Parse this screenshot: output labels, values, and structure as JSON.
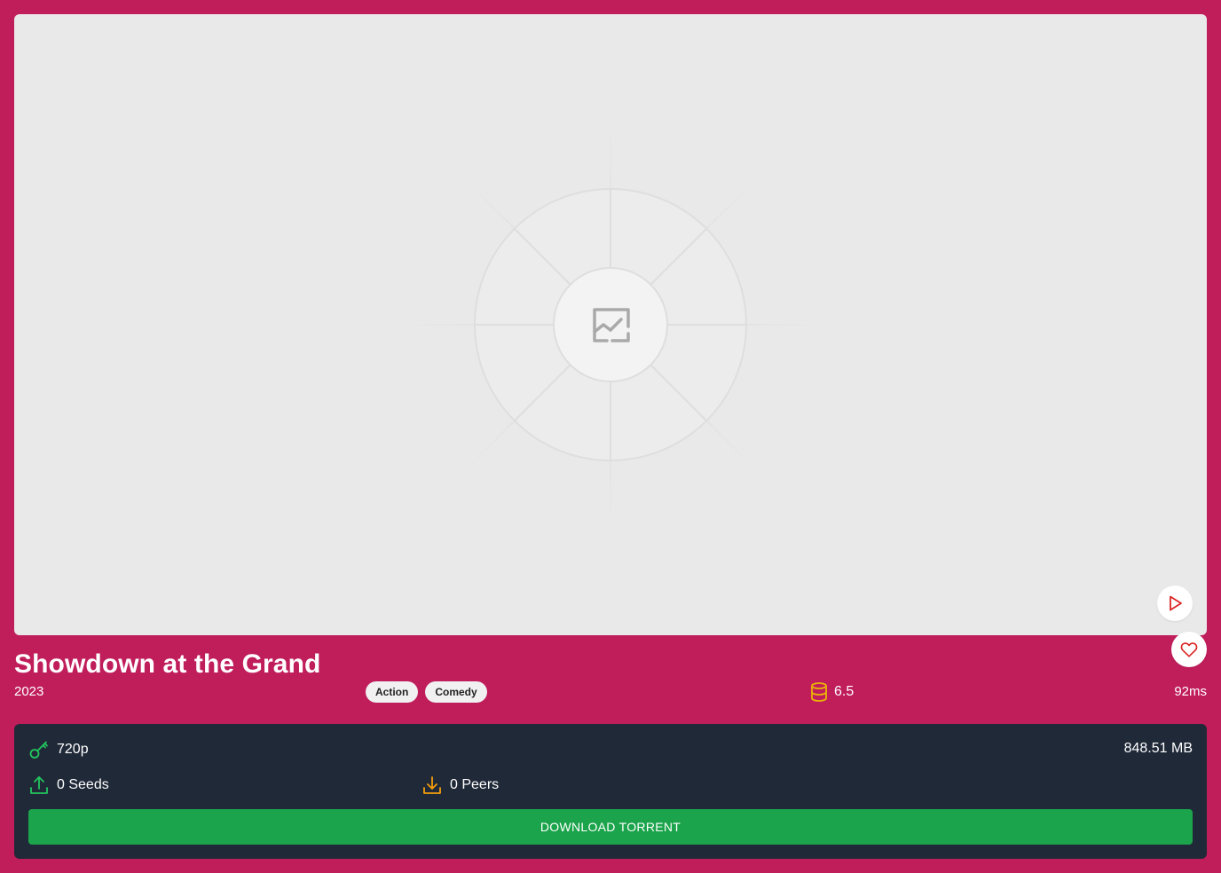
{
  "movie": {
    "title": "Showdown at the Grand",
    "year": "2023",
    "genres": [
      "Action",
      "Comedy"
    ],
    "rating": "6.5",
    "runtime": "92ms"
  },
  "poster": {
    "icon": "image-placeholder-icon"
  },
  "actions": {
    "play_icon": "play-icon",
    "favorite_icon": "heart-icon"
  },
  "torrent": {
    "quality": "720p",
    "size": "848.51 MB",
    "seeds": "0 Seeds",
    "peers": "0 Peers",
    "download_label": "DOWNLOAD TORRENT"
  },
  "colors": {
    "background": "#c01d5b",
    "panel": "#202938",
    "download_button": "#1ba44b",
    "accent_green": "#22c55e",
    "accent_orange": "#f59e0b",
    "rating_icon": "#eab308",
    "play_icon": "#dc2626"
  }
}
